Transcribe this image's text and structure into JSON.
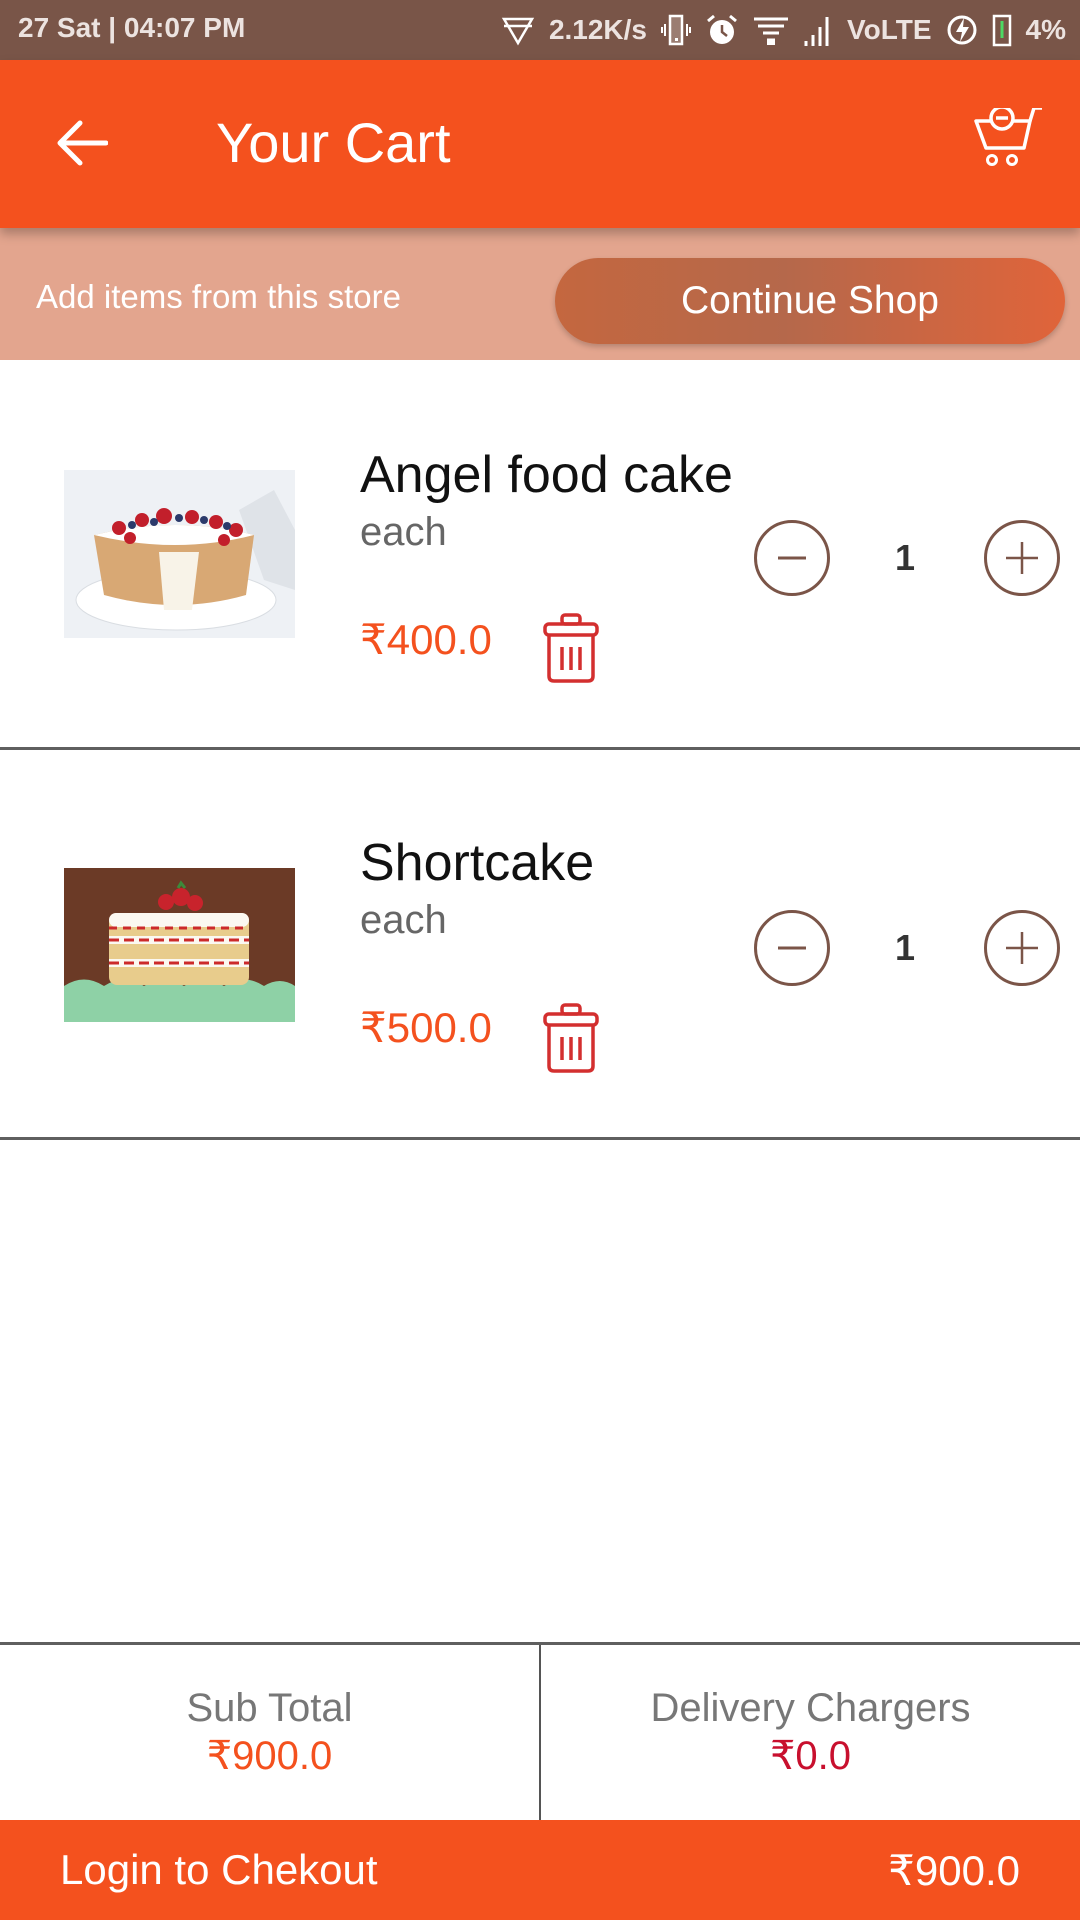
{
  "status_bar": {
    "time": "27 Sat | 04:07 PM",
    "network_speed": "2.12K/s",
    "network_type": "VoLTE",
    "battery": "4%",
    "icons": [
      "data-saver-icon",
      "vibrate-icon",
      "alarm-icon",
      "wifi-icon",
      "signal-icon",
      "charging-icon",
      "battery-icon"
    ]
  },
  "header": {
    "title": "Your Cart",
    "back_icon": "arrow-left-icon",
    "cart_icon": "cart-remove-icon"
  },
  "store_strip": {
    "text": "Add items from this store",
    "button_label": "Continue Shop"
  },
  "items": [
    {
      "name": "Angel food cake",
      "unit": "each",
      "price": "₹400.0",
      "quantity": "1",
      "image": "angel-food-cake-photo"
    },
    {
      "name": "Shortcake",
      "unit": "each",
      "price": "₹500.0",
      "quantity": "1",
      "image": "strawberry-shortcake-photo"
    }
  ],
  "totals": {
    "subtotal_label": "Sub Total",
    "subtotal_value": "₹900.0",
    "delivery_label": "Delivery Chargers",
    "delivery_value": "₹0.0"
  },
  "checkout": {
    "label": "Login to Chekout",
    "amount": "₹900.0"
  },
  "colors": {
    "primary": "#f4511e",
    "status_bar": "#795548",
    "store_strip": "#e3a58e",
    "delete": "#d32f2f",
    "delivery_value": "#c8102e"
  }
}
